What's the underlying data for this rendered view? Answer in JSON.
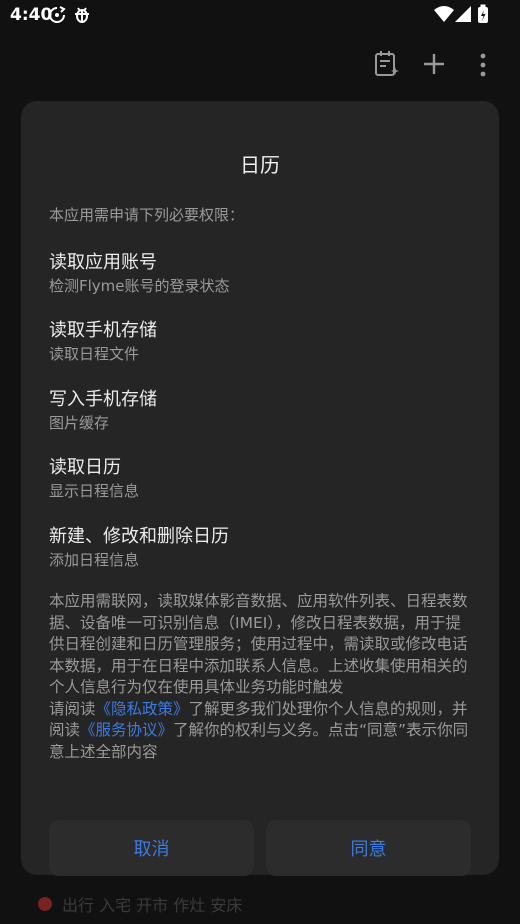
{
  "status_bar": {
    "time": "4:40"
  },
  "background": {
    "partial_text": "出行 入宅 开市 作灶 安床"
  },
  "dialog": {
    "title": "日历",
    "intro": "本应用需申请下列必要权限：",
    "permissions": [
      {
        "title": "读取应用账号",
        "desc": "检测Flyme账号的登录状态"
      },
      {
        "title": "读取手机存储",
        "desc": "读取日程文件"
      },
      {
        "title": "写入手机存储",
        "desc": "图片缓存"
      },
      {
        "title": "读取日历",
        "desc": "显示日程信息"
      },
      {
        "title": "新建、修改和删除日历",
        "desc": "添加日程信息"
      }
    ],
    "notice": {
      "text1": "本应用需联网，读取媒体影音数据、应用软件列表、日程表数据、设备唯一可识别信息（IMEI），修改日程表数据，用于提供日程创建和日历管理服务；使用过程中，需读取或修改电话本数据，用于在日程中添加联系人信息。上述收集使用相关的个人信息行为仅在使用具体业务功能时触发",
      "read_prefix": "请阅读",
      "privacy_link": "《隐私政策》",
      "mid": "了解更多我们处理你个人信息的规则，并阅读",
      "service_link": "《服务协议》",
      "tail": "了解你的权利与义务。点击“同意”表示你同意上述全部内容"
    },
    "cancel_label": "取消",
    "agree_label": "同意"
  },
  "colors": {
    "accent": "#3d7be0",
    "dialog_bg": "#252525",
    "page_bg": "#111111"
  }
}
